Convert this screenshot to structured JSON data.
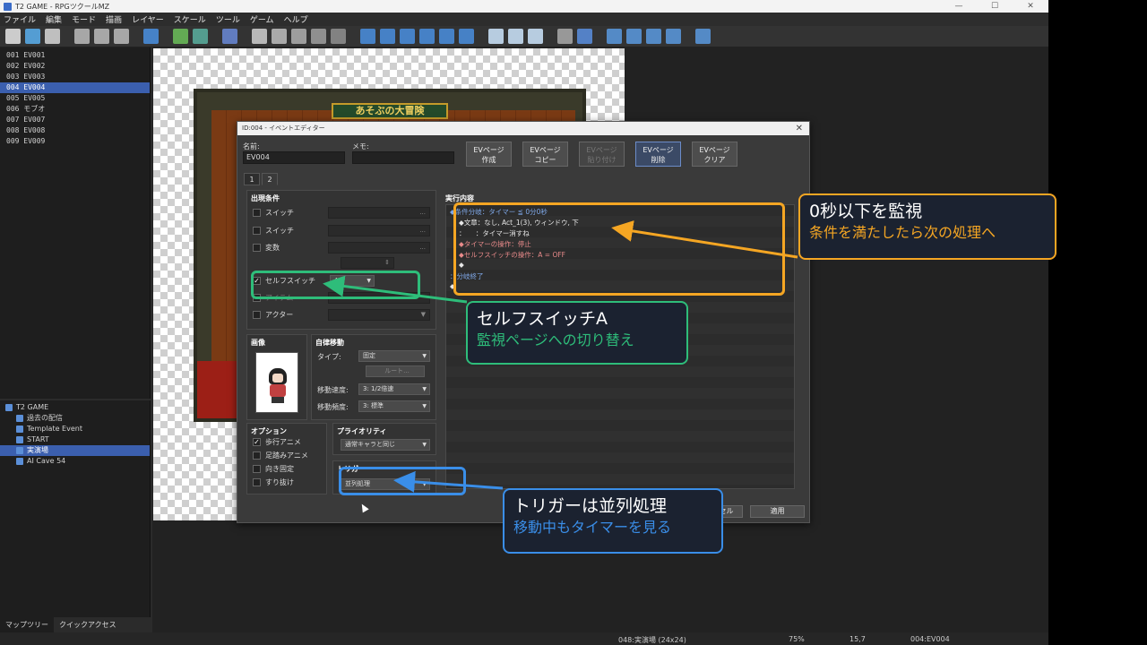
{
  "window": {
    "title": "T2 GAME - RPGツクールMZ",
    "controls": [
      "—",
      "☐",
      "✕"
    ]
  },
  "menu": [
    "ファイル",
    "編集",
    "モード",
    "描画",
    "レイヤー",
    "スケール",
    "ツール",
    "ゲーム",
    "ヘルプ"
  ],
  "toolbar_icons": [
    "new-icon",
    "open-icon",
    "save-icon",
    "cut-icon",
    "copy-icon",
    "paste-icon",
    "undo-icon",
    "map-mode-icon",
    "event-mode-icon",
    "region-icon",
    "layer1-icon",
    "layer2-icon",
    "layer3-icon",
    "layer4-icon",
    "layer5-icon",
    "pencil-icon",
    "eraser-icon",
    "rect-icon",
    "ellipse-icon",
    "fill-icon",
    "shadow-pen-icon",
    "zoom-in-icon",
    "zoom-out-icon",
    "zoom-actual-icon",
    "database-icon",
    "plugin-icon",
    "sound-icon",
    "resource-icon",
    "search-icon",
    "character-icon",
    "playtest-icon"
  ],
  "map_list": [
    {
      "label": "001  EV001",
      "selected": false
    },
    {
      "label": "002  EV002",
      "selected": false
    },
    {
      "label": "003  EV003",
      "selected": false
    },
    {
      "label": "004  EV004",
      "selected": true
    },
    {
      "label": "005  EV005",
      "selected": false
    },
    {
      "label": "006  モブオ",
      "selected": false
    },
    {
      "label": "007  EV007",
      "selected": false
    },
    {
      "label": "008  EV008",
      "selected": false
    },
    {
      "label": "009  EV009",
      "selected": false
    }
  ],
  "map_tree": [
    {
      "label": "T2 GAME",
      "indent": 0,
      "selected": false
    },
    {
      "label": "過去の配信",
      "indent": 1,
      "selected": false
    },
    {
      "label": "Template Event",
      "indent": 1,
      "selected": false
    },
    {
      "label": "START",
      "indent": 1,
      "selected": false
    },
    {
      "label": "実演場",
      "indent": 1,
      "selected": true
    },
    {
      "label": "AI Cave 54",
      "indent": 1,
      "selected": false
    }
  ],
  "left_tabs": [
    "マップツリー",
    "クイックアクセス"
  ],
  "map_banner": "あそぶの大冒険",
  "statusbar": {
    "map": "048:実演場 (24x24)",
    "zoom": "75%",
    "coord": "15,7",
    "event": "004:EV004"
  },
  "dialog": {
    "title": "ID:004 - イベントエディター",
    "name_label": "名前:",
    "name_value": "EV004",
    "memo_label": "メモ:",
    "memo_value": "",
    "page_buttons": [
      {
        "line1": "EVページ",
        "line2": "作成",
        "state": "normal"
      },
      {
        "line1": "EVページ",
        "line2": "コピー",
        "state": "normal"
      },
      {
        "line1": "EVページ",
        "line2": "貼り付け",
        "state": "disabled"
      },
      {
        "line1": "EVページ",
        "line2": "削除",
        "state": "active"
      },
      {
        "line1": "EVページ",
        "line2": "クリア",
        "state": "normal"
      }
    ],
    "tabs": [
      "1",
      "2"
    ],
    "conditions_title": "出現条件",
    "conditions": [
      {
        "label": "スイッチ",
        "checked": false
      },
      {
        "label": "スイッチ",
        "checked": false
      },
      {
        "label": "変数",
        "checked": false
      },
      {
        "label": "セルフスイッチ",
        "checked": true,
        "value": "A"
      },
      {
        "label": "アイテム",
        "checked": false
      },
      {
        "label": "アクター",
        "checked": false
      }
    ],
    "image_title": "画像",
    "autonomous_title": "自律移動",
    "type_label": "タイプ:",
    "type_value": "固定",
    "route_label": "ルート...",
    "speed_label": "移動速度:",
    "speed_value": "3: 1/2倍速",
    "freq_label": "移動頻度:",
    "freq_value": "3: 標準",
    "options_title": "オプション",
    "options": [
      {
        "label": "歩行アニメ",
        "checked": true
      },
      {
        "label": "足踏みアニメ",
        "checked": false
      },
      {
        "label": "向き固定",
        "checked": false
      },
      {
        "label": "すり抜け",
        "checked": false
      }
    ],
    "priority_title": "プライオリティ",
    "priority_value": "通常キャラと同じ",
    "trigger_title": "トリガー",
    "trigger_value": "並列処理",
    "contents_title": "実行内容",
    "commands": [
      {
        "text": "◆条件分岐：タイマー ≦ 0分0秒",
        "color": "blue",
        "indent": 0
      },
      {
        "text": "◆文章：なし, Act_1(3), ウィンドウ, 下",
        "color": "white",
        "indent": 1
      },
      {
        "text": "：　　：タイマー消すね",
        "color": "white",
        "indent": 1
      },
      {
        "text": "◆タイマーの操作：停止",
        "color": "pink",
        "indent": 1
      },
      {
        "text": "◆セルフスイッチの操作：A = OFF",
        "color": "pink",
        "indent": 1
      },
      {
        "text": "◆",
        "color": "white",
        "indent": 1
      },
      {
        "text": "：分岐終了",
        "color": "blue",
        "indent": 0
      },
      {
        "text": "◆",
        "color": "white",
        "indent": 0
      }
    ],
    "cancel_label": "キャンセル",
    "apply_label": "適用"
  },
  "annotations": [
    {
      "id": "timer",
      "main": "0秒以下を監視",
      "sub": "条件を満たしたら次の処理へ",
      "color": "#f5a623"
    },
    {
      "id": "selfswitch",
      "main": "セルフスイッチA",
      "sub": "監視ページへの切り替え",
      "color": "#2ebd7a"
    },
    {
      "id": "trigger",
      "main": "トリガーは並列処理",
      "sub": "移動中もタイマーを見る",
      "color": "#3a8ee8"
    }
  ]
}
